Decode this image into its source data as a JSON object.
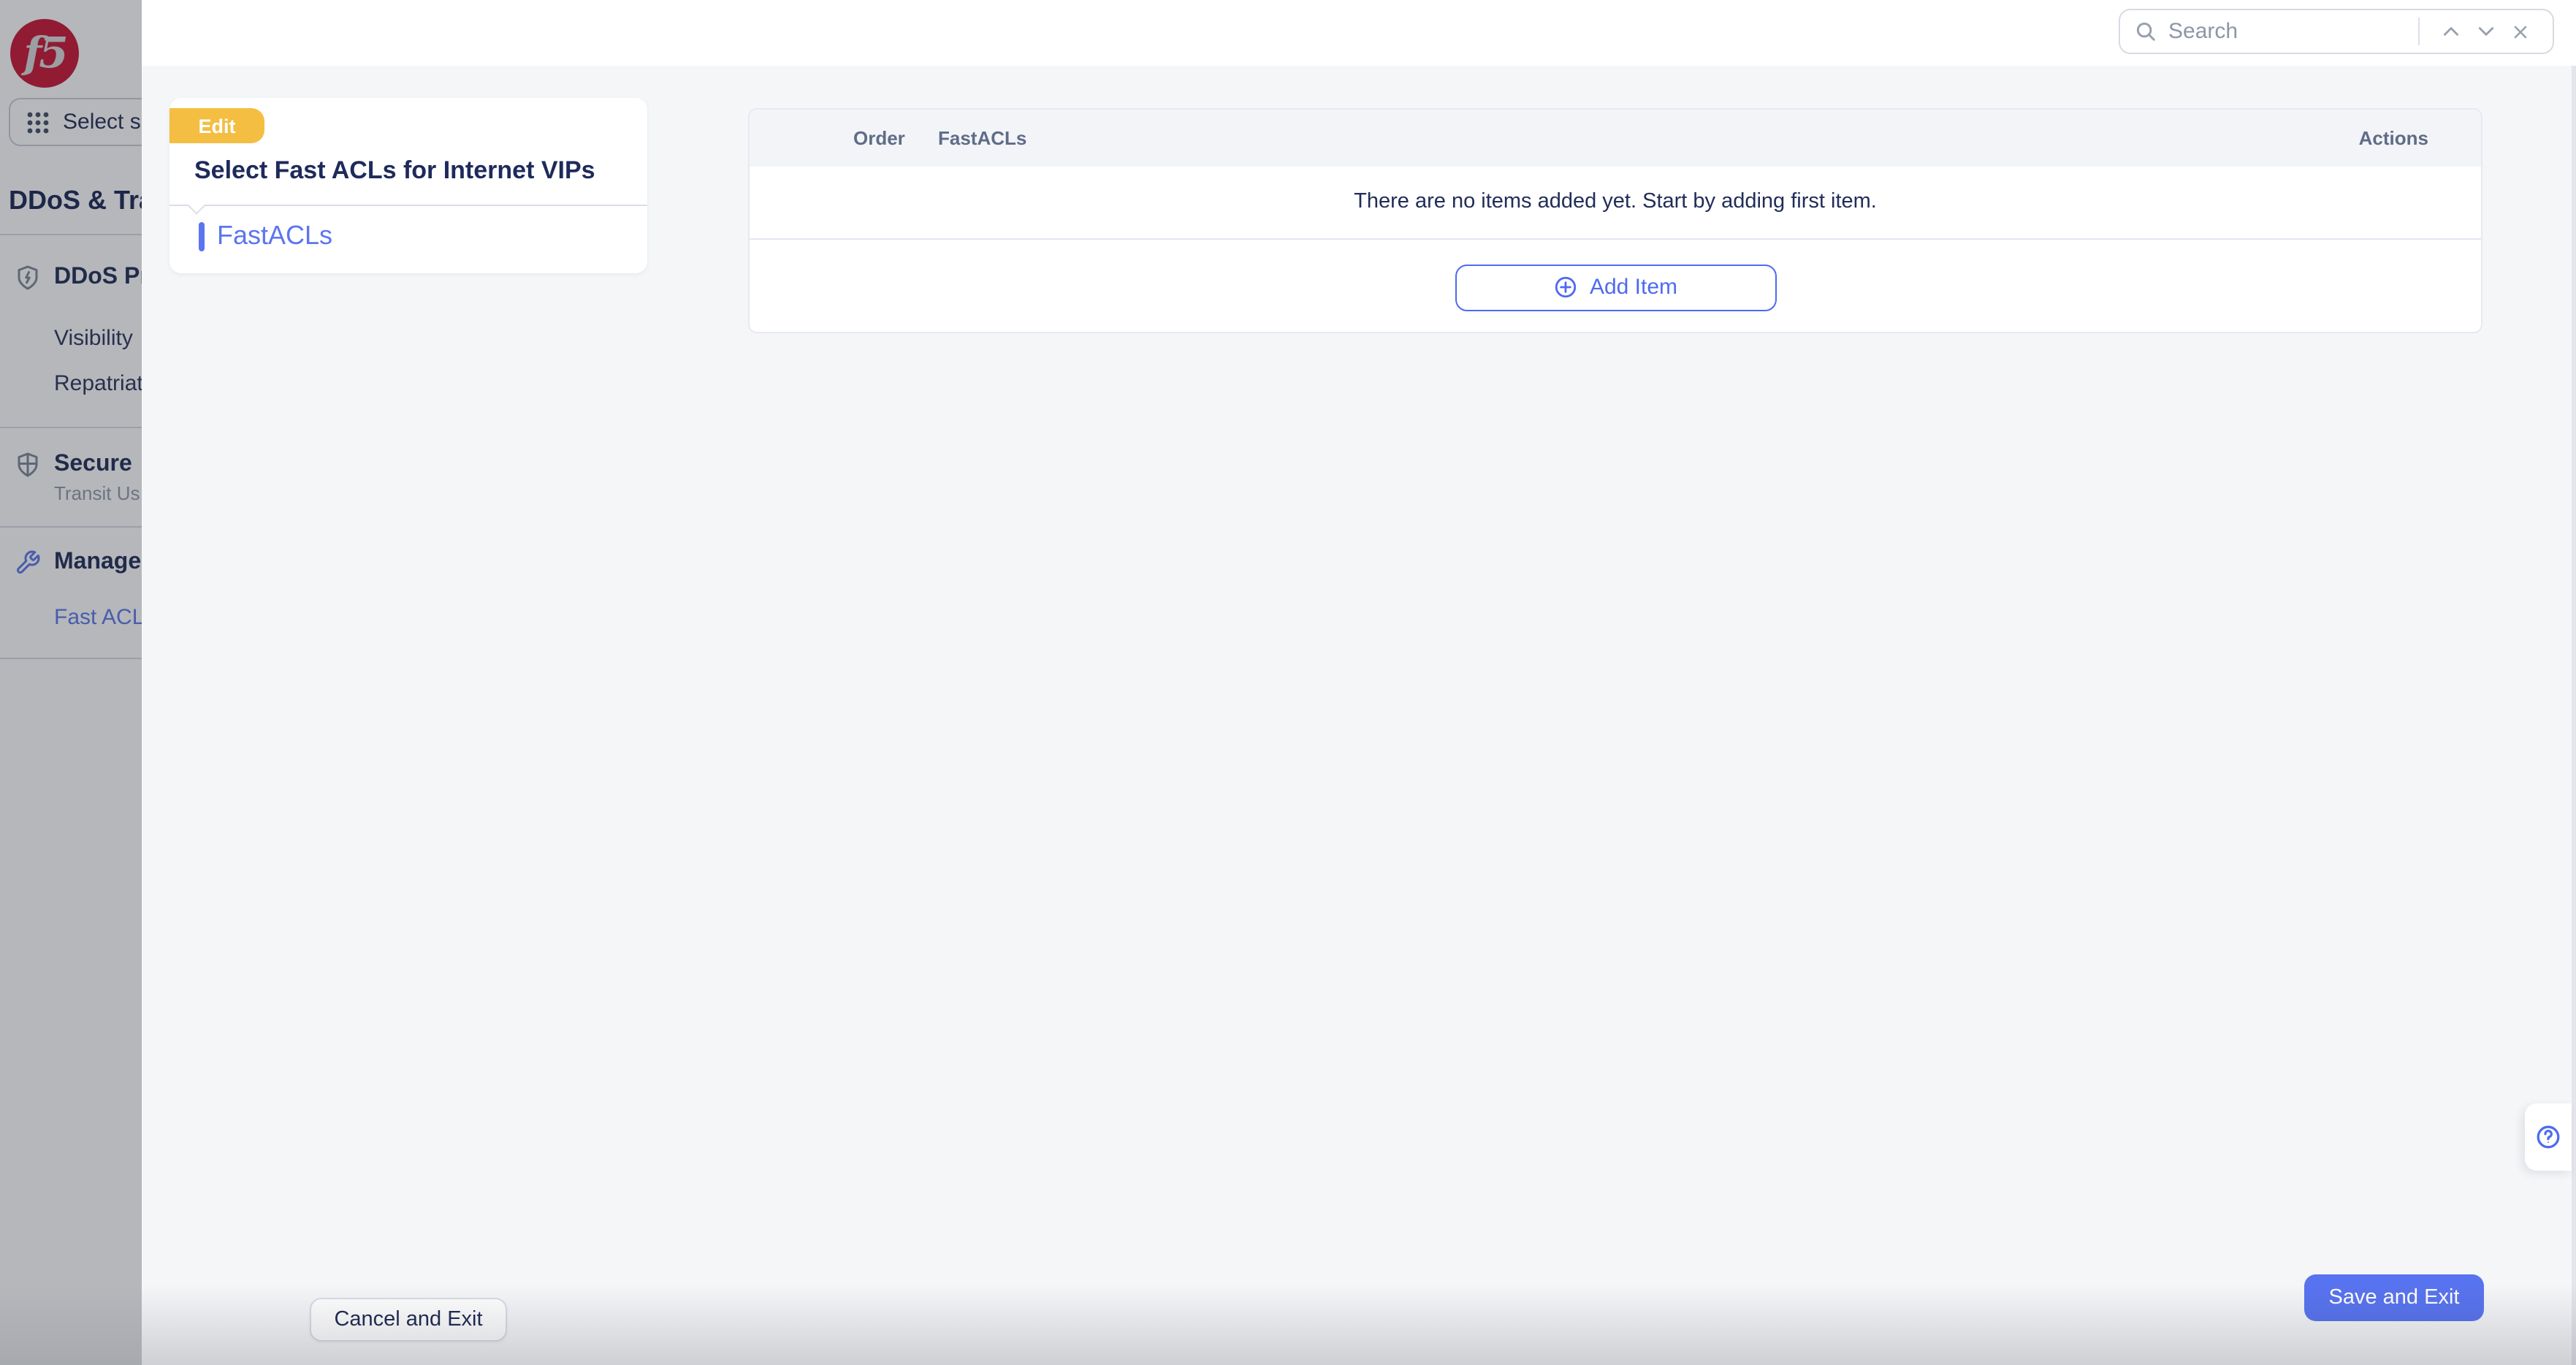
{
  "sidebar": {
    "logo_text": "f5",
    "service_selector": {
      "label": "Select se"
    },
    "nav_heading": "DDoS & Tra",
    "sections": [
      {
        "title": "DDoS Pr",
        "icon": "shield-bolt-icon",
        "items": [
          "Visibility",
          "Repatriat"
        ]
      },
      {
        "title": "Secure",
        "icon": "shield-icon",
        "subtitle": "Transit Us"
      },
      {
        "title": "Manage",
        "icon": "wrench-icon",
        "link": "Fast ACL"
      }
    ]
  },
  "modal": {
    "search": {
      "placeholder": "Search"
    },
    "panel": {
      "badge": "Edit",
      "title": "Select Fast ACLs for Internet VIPs",
      "nav_items": [
        {
          "label": "FastACLs"
        }
      ]
    },
    "table": {
      "columns": {
        "order": "Order",
        "fastacls": "FastACLs",
        "actions": "Actions"
      },
      "empty_message": "There are no items added yet. Start by adding first item.",
      "add_button_label": "Add Item"
    },
    "footer": {
      "cancel_label": "Cancel and Exit",
      "save_label": "Save and Exit"
    }
  },
  "colors": {
    "accent_blue": "#4e6af0",
    "save_button": "#5873ef",
    "edit_badge_yellow": "#f3be41",
    "navy_text": "#1e2a5a",
    "logo_red": "#c8102e",
    "body_background": "#f5f6f8"
  }
}
